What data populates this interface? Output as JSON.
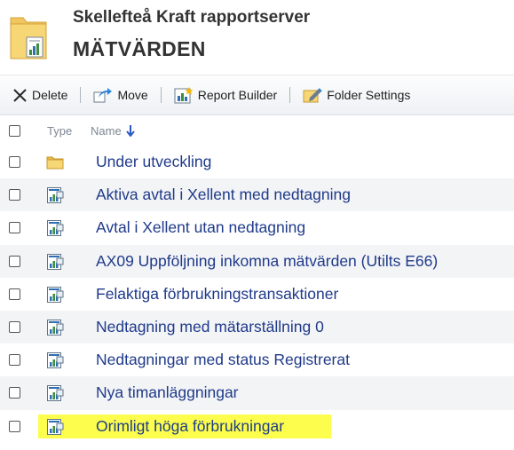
{
  "header": {
    "site_title": "Skellefteå Kraft rapportserver",
    "folder_title": "MÄTVÄRDEN",
    "folder_icon": "folder-report-icon"
  },
  "toolbar": {
    "delete_label": "Delete",
    "move_label": "Move",
    "report_builder_label": "Report Builder",
    "folder_settings_label": "Folder Settings"
  },
  "list": {
    "type_header": "Type",
    "name_header": "Name",
    "sort_direction": "ascending",
    "items": [
      {
        "name": "Under utveckling",
        "type": "folder"
      },
      {
        "name": "Aktiva avtal i Xellent med nedtagning",
        "type": "report"
      },
      {
        "name": "Avtal i Xellent utan nedtagning",
        "type": "report"
      },
      {
        "name": "AX09 Uppföljning inkomna mätvärden (Utilts E66)",
        "type": "report"
      },
      {
        "name": "Felaktiga förbrukningstransaktioner",
        "type": "report"
      },
      {
        "name": "Nedtagning med mätarställning 0",
        "type": "report"
      },
      {
        "name": "Nedtagningar med status Registrerat",
        "type": "report"
      },
      {
        "name": "Nya timanläggningar",
        "type": "report"
      },
      {
        "name": "Orimligt höga förbrukningar",
        "type": "report",
        "highlighted": true
      }
    ]
  },
  "colors": {
    "link": "#1f3a8a",
    "highlight": "#fdfd4d",
    "row_alt": "#f3f4f6",
    "header_text": "#333333"
  }
}
